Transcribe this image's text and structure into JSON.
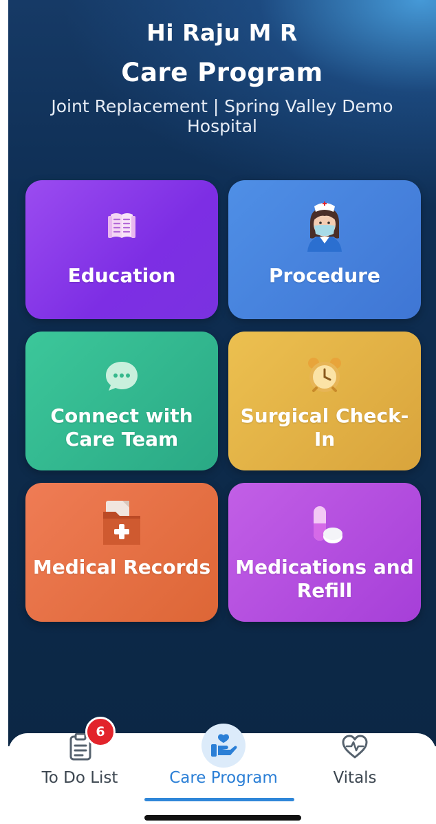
{
  "header": {
    "greeting": "Hi Raju M R",
    "title": "Care Program",
    "subtitle": "Joint Replacement | Spring Valley Demo Hospital"
  },
  "tiles": [
    {
      "label": "Education",
      "icon": "book-icon",
      "color": "#8a3be8"
    },
    {
      "label": "Procedure",
      "icon": "nurse-icon",
      "color": "#4580da"
    },
    {
      "label": "Connect with Care Team",
      "icon": "chat-bubble-icon",
      "color": "#34b98f"
    },
    {
      "label": "Surgical Check-In",
      "icon": "alarm-clock-icon",
      "color": "#e2b146"
    },
    {
      "label": "Medical Records",
      "icon": "medical-folder-icon",
      "color": "#e67146"
    },
    {
      "label": "Medications and Refill",
      "icon": "pills-icon",
      "color": "#b34edf"
    }
  ],
  "bottom_nav": {
    "items": [
      {
        "label": "To Do List",
        "icon": "clipboard-icon",
        "badge": "6"
      },
      {
        "label": "Care Program",
        "icon": "care-hand-icon",
        "active": true
      },
      {
        "label": "Vitals",
        "icon": "heart-pulse-icon"
      }
    ],
    "active_color": "#2b7fd6",
    "badge_color": "#e2242b"
  }
}
